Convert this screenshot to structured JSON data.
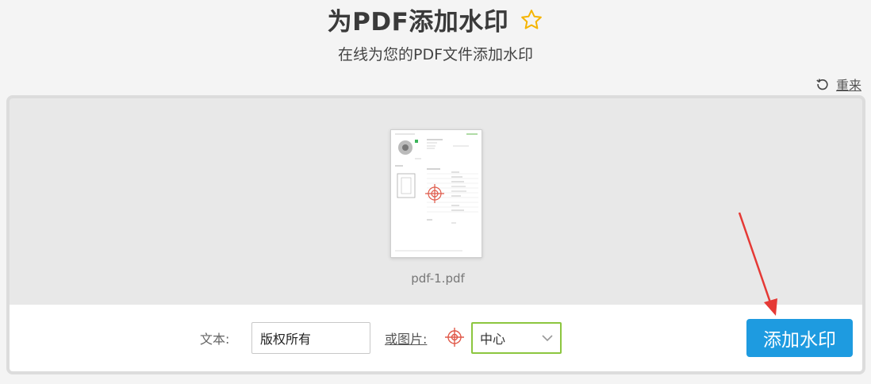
{
  "header": {
    "title": "为PDF添加水印",
    "subtitle": "在线为您的PDF文件添加水印"
  },
  "reset": {
    "label": "重来"
  },
  "file": {
    "name": "pdf-1.pdf"
  },
  "toolbar": {
    "text_label": "文本:",
    "text_value": "版权所有",
    "image_label": "或图片:",
    "position_value": "中心",
    "add_button_label": "添加水印"
  },
  "colors": {
    "accent_button": "#1e9be0",
    "select_border": "#8cc63f",
    "star": "#f5b400",
    "target": "#e05a4a",
    "annotation_arrow": "#e53935"
  }
}
